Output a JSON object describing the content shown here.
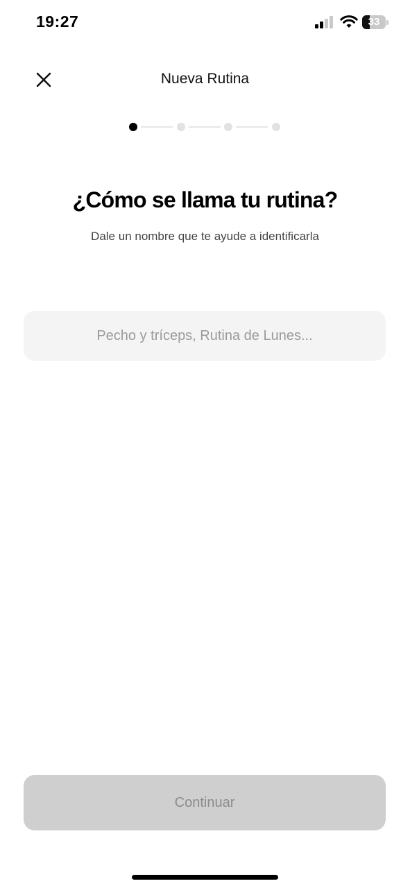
{
  "status_bar": {
    "time": "19:27",
    "battery_level": "33",
    "battery_fraction": 0.33,
    "signal_bars_active": 2,
    "signal_bars_total": 4
  },
  "header": {
    "title": "Nueva Rutina",
    "close_icon": "close-icon"
  },
  "stepper": {
    "total_steps": 4,
    "current_step": 1
  },
  "question": {
    "title": "¿Cómo se llama tu rutina?",
    "subtitle": "Dale un nombre que te ayude a identificarla"
  },
  "name_input": {
    "value": "",
    "placeholder": "Pecho y tríceps, Rutina de Lunes..."
  },
  "footer": {
    "continue_label": "Continuar",
    "enabled": false
  },
  "colors": {
    "accent": "#000000",
    "input_background": "#f4f4f4",
    "button_disabled_background": "#cfcfcf",
    "button_disabled_text": "#8c8c8c",
    "step_inactive": "#e2e2e2"
  }
}
